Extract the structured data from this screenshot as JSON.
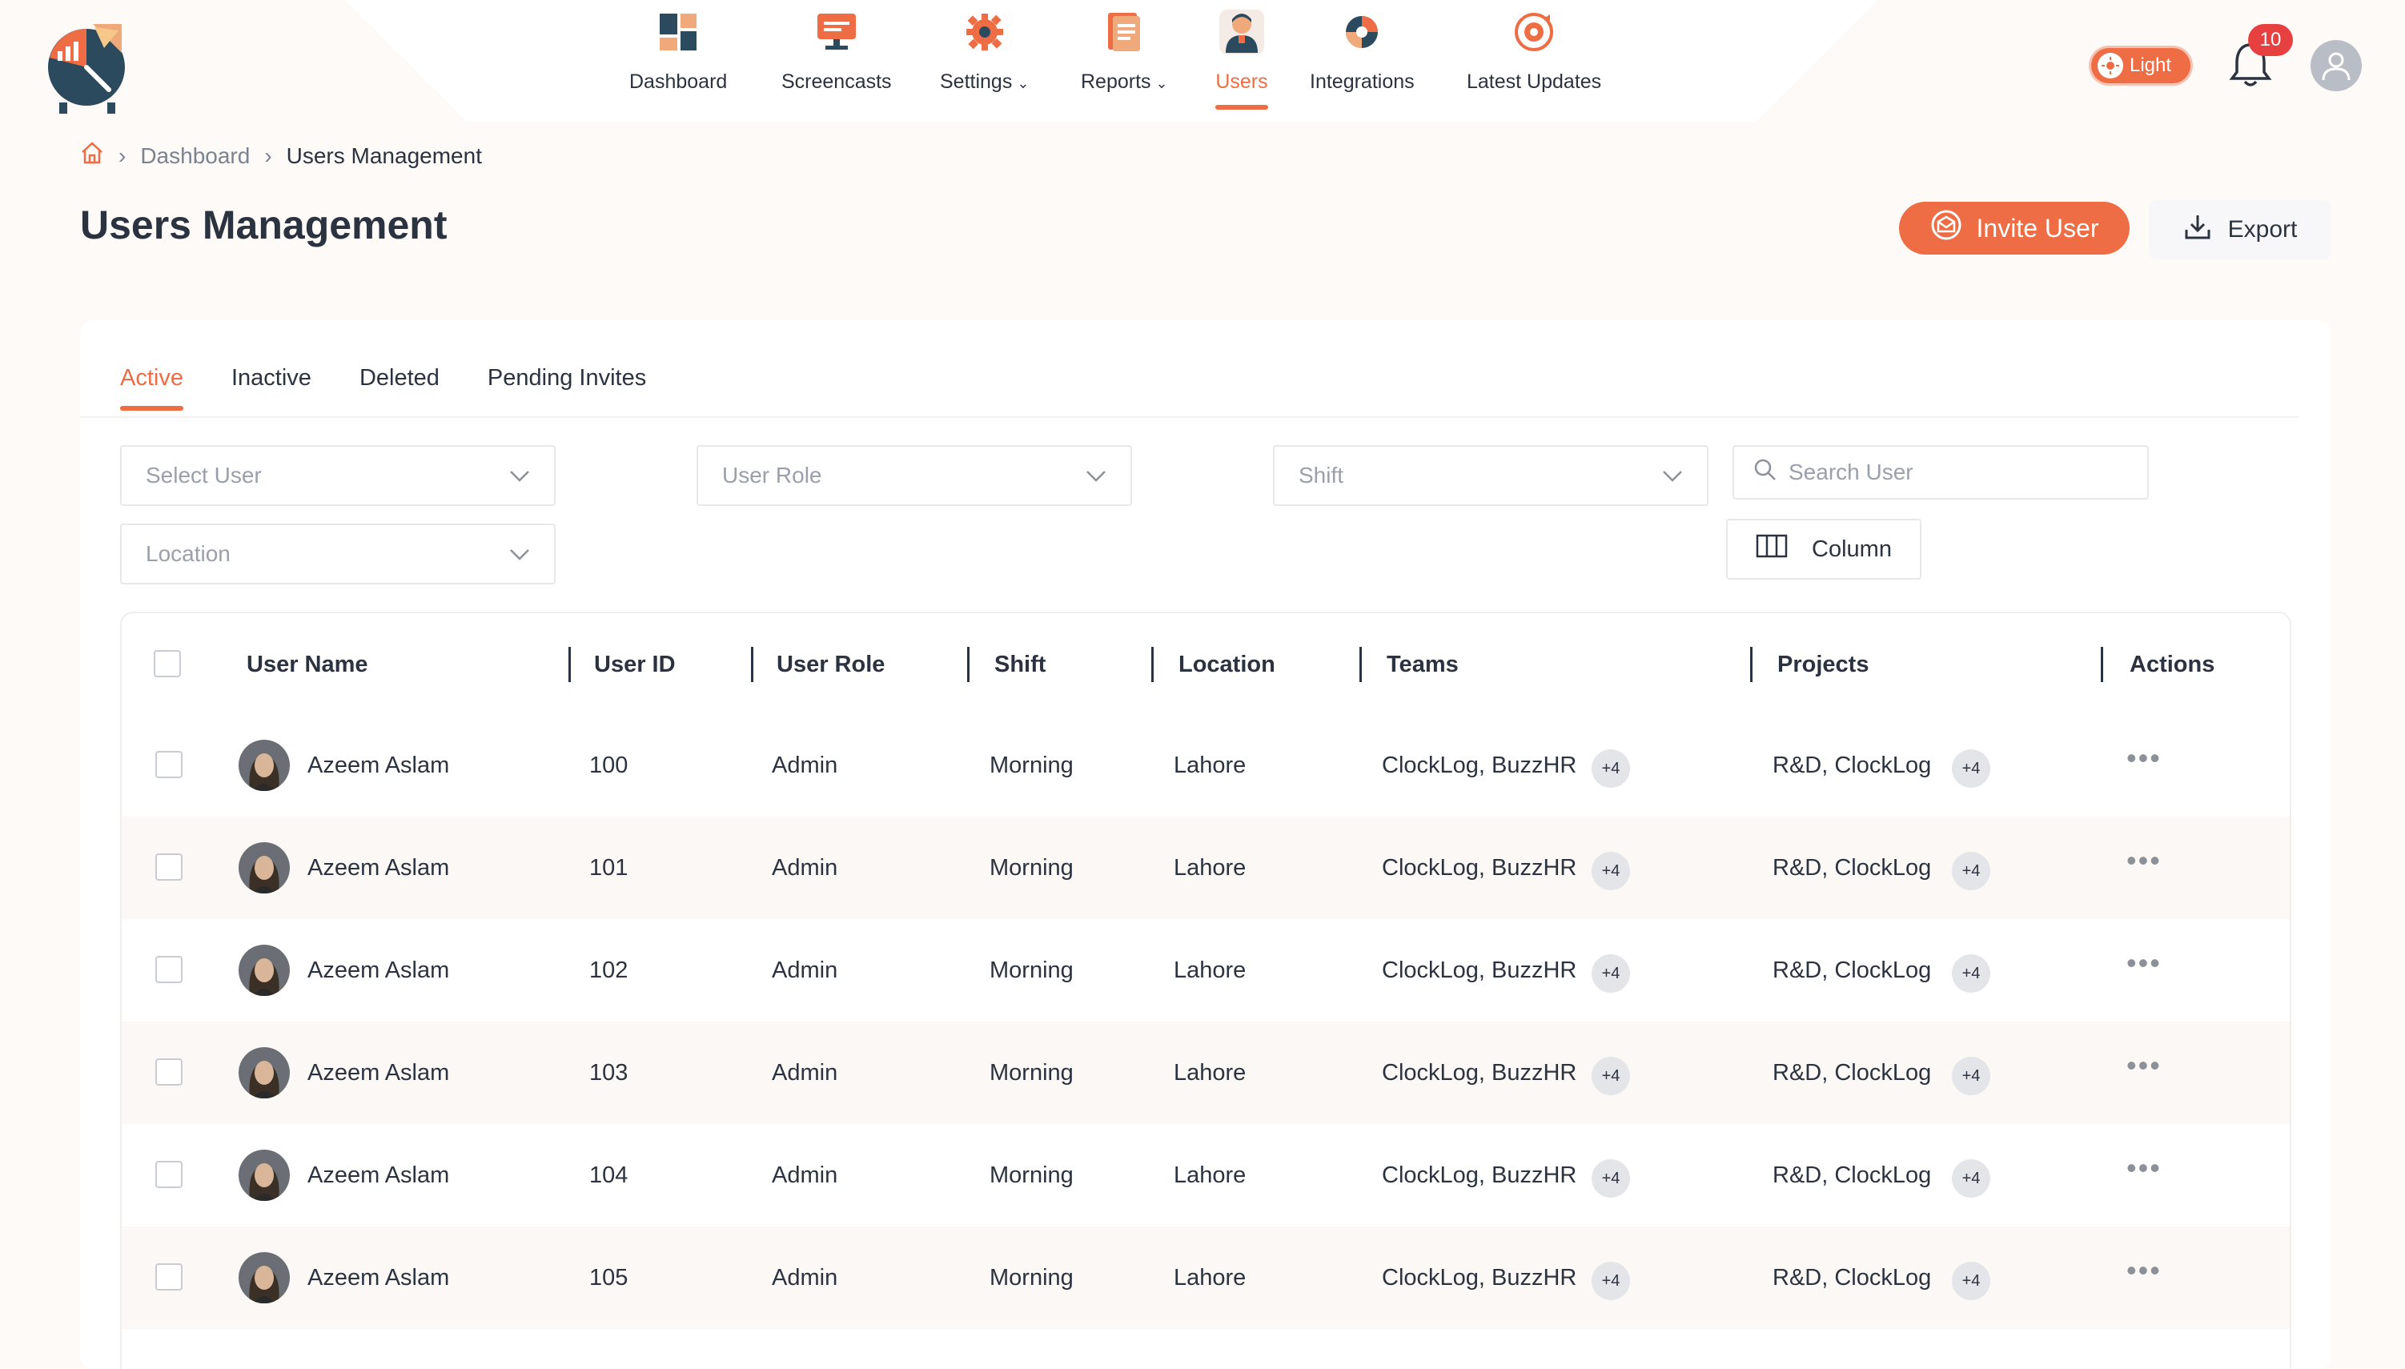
{
  "nav": {
    "items": [
      {
        "label": "Dashboard",
        "icon": "dashboard-icon"
      },
      {
        "label": "Screencasts",
        "icon": "screencast-icon"
      },
      {
        "label": "Settings",
        "icon": "gear-icon"
      },
      {
        "label": "Reports",
        "icon": "report-icon"
      },
      {
        "label": "Users",
        "icon": "user-icon"
      },
      {
        "label": "Integrations",
        "icon": "puzzle-icon"
      },
      {
        "label": "Latest Updates",
        "icon": "updates-icon"
      }
    ],
    "active": "Users",
    "theme_label": "Light",
    "notification_count": "10"
  },
  "breadcrumb": {
    "home": "home-icon",
    "items": [
      "Dashboard",
      "Users Management"
    ]
  },
  "page": {
    "title": "Users Management",
    "invite_label": "Invite User",
    "export_label": "Export"
  },
  "tabs": [
    "Active",
    "Inactive",
    "Deleted",
    "Pending Invites"
  ],
  "filters": {
    "select_user": "Select User",
    "user_role": "User Role",
    "shift": "Shift",
    "location": "Location",
    "search_placeholder": "Search User",
    "column_label": "Column"
  },
  "table": {
    "headers": [
      "User Name",
      "User ID",
      "User Role",
      "Shift",
      "Location",
      "Teams",
      "Projects",
      "Actions"
    ],
    "rows": [
      {
        "name": "Azeem Aslam",
        "id": "100",
        "role": "Admin",
        "shift": "Morning",
        "location": "Lahore",
        "teams": "ClockLog, BuzzHR",
        "teams_more": "+4",
        "projects": "R&D, ClockLog",
        "projects_more": "+4"
      },
      {
        "name": "Azeem Aslam",
        "id": "101",
        "role": "Admin",
        "shift": "Morning",
        "location": "Lahore",
        "teams": "ClockLog, BuzzHR",
        "teams_more": "+4",
        "projects": "R&D, ClockLog",
        "projects_more": "+4"
      },
      {
        "name": "Azeem Aslam",
        "id": "102",
        "role": "Admin",
        "shift": "Morning",
        "location": "Lahore",
        "teams": "ClockLog, BuzzHR",
        "teams_more": "+4",
        "projects": "R&D, ClockLog",
        "projects_more": "+4"
      },
      {
        "name": "Azeem Aslam",
        "id": "103",
        "role": "Admin",
        "shift": "Morning",
        "location": "Lahore",
        "teams": "ClockLog, BuzzHR",
        "teams_more": "+4",
        "projects": "R&D, ClockLog",
        "projects_more": "+4"
      },
      {
        "name": "Azeem Aslam",
        "id": "104",
        "role": "Admin",
        "shift": "Morning",
        "location": "Lahore",
        "teams": "ClockLog, BuzzHR",
        "teams_more": "+4",
        "projects": "R&D, ClockLog",
        "projects_more": "+4"
      },
      {
        "name": "Azeem Aslam",
        "id": "105",
        "role": "Admin",
        "shift": "Morning",
        "location": "Lahore",
        "teams": "ClockLog, BuzzHR",
        "teams_more": "+4",
        "projects": "R&D, ClockLog",
        "projects_more": "+4"
      }
    ]
  },
  "colors": {
    "accent": "#ee6d44",
    "text": "#2b3340",
    "muted": "#9aa0ab"
  }
}
